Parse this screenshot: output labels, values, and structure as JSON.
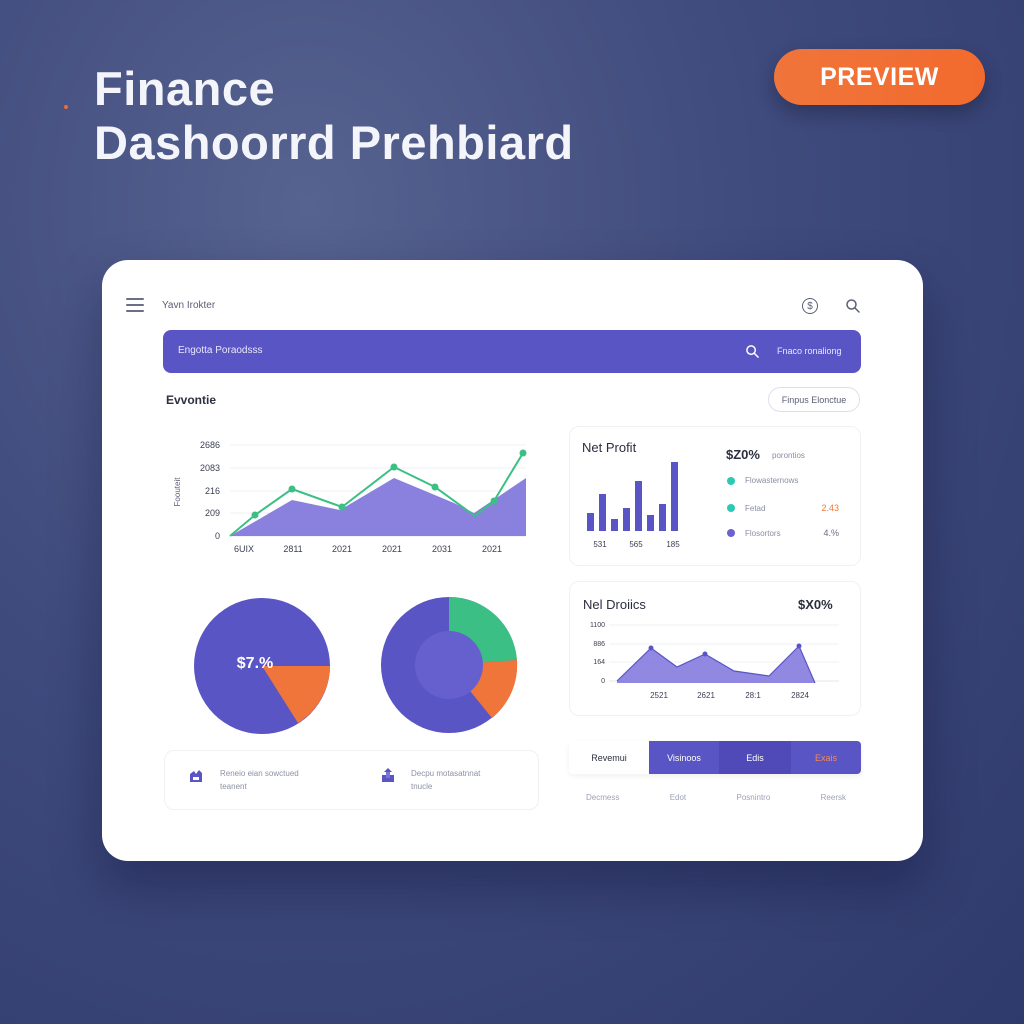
{
  "headline": {
    "line1": "Finance",
    "line2": "Dashoorrd Prehbiard"
  },
  "preview_label": "PREVIEW",
  "topbar": {
    "title": "Yavn Irokter",
    "coin_glyph": "$"
  },
  "search": {
    "placeholder": "Engotta Poraodsss",
    "action_label": "Fnaco ronaliong"
  },
  "section": {
    "title": "Evvontie",
    "pill_label": "Finpus Elonctue"
  },
  "line_chart": {
    "ylabel": "Foouteit",
    "yticks": [
      "2686",
      "2083",
      "216",
      "209",
      "0"
    ],
    "xticks": [
      "6UIX",
      "2811",
      "2021",
      "2021",
      "2031",
      "2021"
    ]
  },
  "net_profit": {
    "title": "Net Profit",
    "value": "$Z0%",
    "value_sub": "porontios",
    "xticks": [
      "531",
      "565",
      "185"
    ],
    "legend": [
      {
        "label": "Flowasternows",
        "value": "",
        "color": "#2ec9b5"
      },
      {
        "label": "Fetad",
        "value": "2.43",
        "color": "#2ec9b5",
        "value_color": "#f07a3a"
      },
      {
        "label": "Flosortors",
        "value": "4.%",
        "color": "#6a61d3",
        "value_color": "#6b6f85"
      }
    ]
  },
  "pie1": {
    "center_label": "$7.%"
  },
  "net_profits": {
    "title": "Nel Droiics",
    "value": "$X0%",
    "yticks": [
      "1100",
      "886",
      "164",
      "0"
    ],
    "xticks": [
      "2521",
      "2621",
      "28:1",
      "2824"
    ]
  },
  "info": [
    {
      "line1": "Reneio eian sowctued",
      "line2": "teanent"
    },
    {
      "line1": "Decpu motasatnnat",
      "line2": "tnucle"
    }
  ],
  "tabs": [
    {
      "label": "Revemui"
    },
    {
      "label": "Visinoos"
    },
    {
      "label": "Edis"
    },
    {
      "label": "Exais"
    }
  ],
  "sub_labels": [
    "Decmess",
    "Edot",
    "Posnintro",
    "Reersk"
  ],
  "colors": {
    "accent": "#5a55c5",
    "orange": "#f0753a",
    "green": "#3cbf85",
    "teal": "#2ec9b5"
  },
  "chart_data": [
    {
      "type": "area",
      "title": "",
      "ylabel": "Foouteit",
      "x": [
        "6UIX",
        "2811",
        "2021",
        "2021",
        "2031",
        "2021"
      ],
      "series": [
        {
          "values": [
            0,
            100,
            40,
            160,
            80,
            60,
            110
          ]
        },
        {
          "values": [
            0,
            60,
            110,
            80,
            180,
            130,
            60,
            100,
            220
          ]
        }
      ]
    },
    {
      "type": "bar",
      "title": "Net Profit",
      "x": [
        "531",
        "565",
        "185"
      ],
      "series": [
        {
          "values": [
            3,
            9,
            5,
            6,
            4,
            12,
            4,
            6,
            16
          ]
        }
      ]
    },
    {
      "type": "pie",
      "slices": [
        {
          "value": 84,
          "color": "#5a55c5"
        },
        {
          "value": 16,
          "color": "#f0753a"
        }
      ]
    },
    {
      "type": "pie",
      "slices": [
        {
          "value": 62,
          "color": "#5a55c5"
        },
        {
          "value": 18,
          "color": "#f0753a"
        },
        {
          "value": 20,
          "color": "#3cbf85"
        }
      ]
    },
    {
      "type": "area",
      "title": "Nel Droiics",
      "x": [
        "2521",
        "2621",
        "28:1",
        "2824"
      ],
      "series": [
        {
          "values": [
            0,
            380,
            200,
            330,
            150,
            100,
            430,
            0
          ]
        }
      ]
    }
  ]
}
